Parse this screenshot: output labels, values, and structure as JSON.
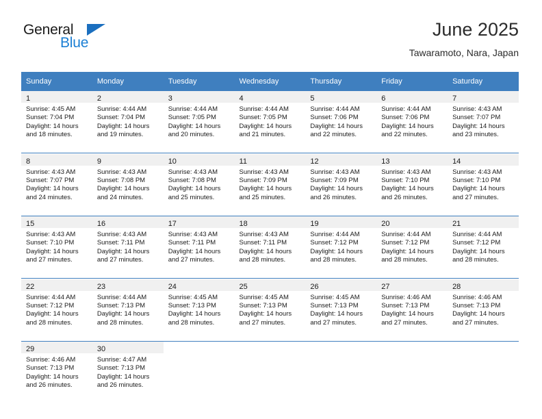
{
  "brand": {
    "line1": "General",
    "line2": "Blue",
    "accent_color": "#1b7fd4",
    "flag_color": "#1b6fbf"
  },
  "header": {
    "title": "June 2025",
    "subtitle": "Tawaramoto, Nara, Japan"
  },
  "theme": {
    "header_row_bg": "#3f7fbf",
    "daynum_band_bg": "#f0f0f0",
    "text_color": "#1a1a1a"
  },
  "columns": [
    "Sunday",
    "Monday",
    "Tuesday",
    "Wednesday",
    "Thursday",
    "Friday",
    "Saturday"
  ],
  "weeks": [
    [
      {
        "day": "1",
        "sunrise": "Sunrise: 4:45 AM",
        "sunset": "Sunset: 7:04 PM",
        "daylight1": "Daylight: 14 hours",
        "daylight2": "and 18 minutes."
      },
      {
        "day": "2",
        "sunrise": "Sunrise: 4:44 AM",
        "sunset": "Sunset: 7:04 PM",
        "daylight1": "Daylight: 14 hours",
        "daylight2": "and 19 minutes."
      },
      {
        "day": "3",
        "sunrise": "Sunrise: 4:44 AM",
        "sunset": "Sunset: 7:05 PM",
        "daylight1": "Daylight: 14 hours",
        "daylight2": "and 20 minutes."
      },
      {
        "day": "4",
        "sunrise": "Sunrise: 4:44 AM",
        "sunset": "Sunset: 7:05 PM",
        "daylight1": "Daylight: 14 hours",
        "daylight2": "and 21 minutes."
      },
      {
        "day": "5",
        "sunrise": "Sunrise: 4:44 AM",
        "sunset": "Sunset: 7:06 PM",
        "daylight1": "Daylight: 14 hours",
        "daylight2": "and 22 minutes."
      },
      {
        "day": "6",
        "sunrise": "Sunrise: 4:44 AM",
        "sunset": "Sunset: 7:06 PM",
        "daylight1": "Daylight: 14 hours",
        "daylight2": "and 22 minutes."
      },
      {
        "day": "7",
        "sunrise": "Sunrise: 4:43 AM",
        "sunset": "Sunset: 7:07 PM",
        "daylight1": "Daylight: 14 hours",
        "daylight2": "and 23 minutes."
      }
    ],
    [
      {
        "day": "8",
        "sunrise": "Sunrise: 4:43 AM",
        "sunset": "Sunset: 7:07 PM",
        "daylight1": "Daylight: 14 hours",
        "daylight2": "and 24 minutes."
      },
      {
        "day": "9",
        "sunrise": "Sunrise: 4:43 AM",
        "sunset": "Sunset: 7:08 PM",
        "daylight1": "Daylight: 14 hours",
        "daylight2": "and 24 minutes."
      },
      {
        "day": "10",
        "sunrise": "Sunrise: 4:43 AM",
        "sunset": "Sunset: 7:08 PM",
        "daylight1": "Daylight: 14 hours",
        "daylight2": "and 25 minutes."
      },
      {
        "day": "11",
        "sunrise": "Sunrise: 4:43 AM",
        "sunset": "Sunset: 7:09 PM",
        "daylight1": "Daylight: 14 hours",
        "daylight2": "and 25 minutes."
      },
      {
        "day": "12",
        "sunrise": "Sunrise: 4:43 AM",
        "sunset": "Sunset: 7:09 PM",
        "daylight1": "Daylight: 14 hours",
        "daylight2": "and 26 minutes."
      },
      {
        "day": "13",
        "sunrise": "Sunrise: 4:43 AM",
        "sunset": "Sunset: 7:10 PM",
        "daylight1": "Daylight: 14 hours",
        "daylight2": "and 26 minutes."
      },
      {
        "day": "14",
        "sunrise": "Sunrise: 4:43 AM",
        "sunset": "Sunset: 7:10 PM",
        "daylight1": "Daylight: 14 hours",
        "daylight2": "and 27 minutes."
      }
    ],
    [
      {
        "day": "15",
        "sunrise": "Sunrise: 4:43 AM",
        "sunset": "Sunset: 7:10 PM",
        "daylight1": "Daylight: 14 hours",
        "daylight2": "and 27 minutes."
      },
      {
        "day": "16",
        "sunrise": "Sunrise: 4:43 AM",
        "sunset": "Sunset: 7:11 PM",
        "daylight1": "Daylight: 14 hours",
        "daylight2": "and 27 minutes."
      },
      {
        "day": "17",
        "sunrise": "Sunrise: 4:43 AM",
        "sunset": "Sunset: 7:11 PM",
        "daylight1": "Daylight: 14 hours",
        "daylight2": "and 27 minutes."
      },
      {
        "day": "18",
        "sunrise": "Sunrise: 4:43 AM",
        "sunset": "Sunset: 7:11 PM",
        "daylight1": "Daylight: 14 hours",
        "daylight2": "and 28 minutes."
      },
      {
        "day": "19",
        "sunrise": "Sunrise: 4:44 AM",
        "sunset": "Sunset: 7:12 PM",
        "daylight1": "Daylight: 14 hours",
        "daylight2": "and 28 minutes."
      },
      {
        "day": "20",
        "sunrise": "Sunrise: 4:44 AM",
        "sunset": "Sunset: 7:12 PM",
        "daylight1": "Daylight: 14 hours",
        "daylight2": "and 28 minutes."
      },
      {
        "day": "21",
        "sunrise": "Sunrise: 4:44 AM",
        "sunset": "Sunset: 7:12 PM",
        "daylight1": "Daylight: 14 hours",
        "daylight2": "and 28 minutes."
      }
    ],
    [
      {
        "day": "22",
        "sunrise": "Sunrise: 4:44 AM",
        "sunset": "Sunset: 7:12 PM",
        "daylight1": "Daylight: 14 hours",
        "daylight2": "and 28 minutes."
      },
      {
        "day": "23",
        "sunrise": "Sunrise: 4:44 AM",
        "sunset": "Sunset: 7:13 PM",
        "daylight1": "Daylight: 14 hours",
        "daylight2": "and 28 minutes."
      },
      {
        "day": "24",
        "sunrise": "Sunrise: 4:45 AM",
        "sunset": "Sunset: 7:13 PM",
        "daylight1": "Daylight: 14 hours",
        "daylight2": "and 28 minutes."
      },
      {
        "day": "25",
        "sunrise": "Sunrise: 4:45 AM",
        "sunset": "Sunset: 7:13 PM",
        "daylight1": "Daylight: 14 hours",
        "daylight2": "and 27 minutes."
      },
      {
        "day": "26",
        "sunrise": "Sunrise: 4:45 AM",
        "sunset": "Sunset: 7:13 PM",
        "daylight1": "Daylight: 14 hours",
        "daylight2": "and 27 minutes."
      },
      {
        "day": "27",
        "sunrise": "Sunrise: 4:46 AM",
        "sunset": "Sunset: 7:13 PM",
        "daylight1": "Daylight: 14 hours",
        "daylight2": "and 27 minutes."
      },
      {
        "day": "28",
        "sunrise": "Sunrise: 4:46 AM",
        "sunset": "Sunset: 7:13 PM",
        "daylight1": "Daylight: 14 hours",
        "daylight2": "and 27 minutes."
      }
    ],
    [
      {
        "day": "29",
        "sunrise": "Sunrise: 4:46 AM",
        "sunset": "Sunset: 7:13 PM",
        "daylight1": "Daylight: 14 hours",
        "daylight2": "and 26 minutes."
      },
      {
        "day": "30",
        "sunrise": "Sunrise: 4:47 AM",
        "sunset": "Sunset: 7:13 PM",
        "daylight1": "Daylight: 14 hours",
        "daylight2": "and 26 minutes."
      },
      {
        "day": "",
        "sunrise": "",
        "sunset": "",
        "daylight1": "",
        "daylight2": ""
      },
      {
        "day": "",
        "sunrise": "",
        "sunset": "",
        "daylight1": "",
        "daylight2": ""
      },
      {
        "day": "",
        "sunrise": "",
        "sunset": "",
        "daylight1": "",
        "daylight2": ""
      },
      {
        "day": "",
        "sunrise": "",
        "sunset": "",
        "daylight1": "",
        "daylight2": ""
      },
      {
        "day": "",
        "sunrise": "",
        "sunset": "",
        "daylight1": "",
        "daylight2": ""
      }
    ]
  ]
}
